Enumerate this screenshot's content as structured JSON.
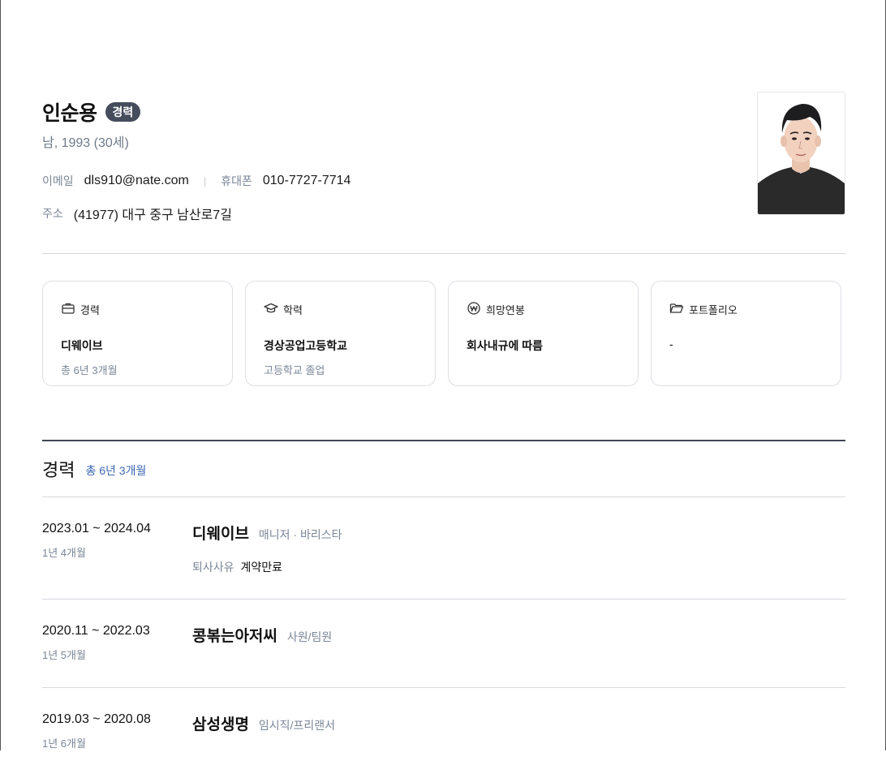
{
  "profile": {
    "name": "인순용",
    "badge": "경력",
    "subtitle": "남, 1993 (30세)",
    "email_label": "이메일",
    "email": "dls910@nate.com",
    "separator": "|",
    "phone_label": "휴대폰",
    "phone": "010-7727-7714",
    "address_label": "주소",
    "address": "(41977) 대구 중구 남산로7길"
  },
  "cards": [
    {
      "icon": "briefcase-icon",
      "title": "경력",
      "main": "디웨이브",
      "sub": "총 6년 3개월"
    },
    {
      "icon": "graduation-cap-icon",
      "title": "학력",
      "main": "경상공업고등학교",
      "sub": "고등학교 졸업"
    },
    {
      "icon": "won-icon",
      "title": "희망연봉",
      "main": "회사내규에 따름",
      "sub": ""
    },
    {
      "icon": "folder-icon",
      "title": "포트폴리오",
      "main": "-",
      "sub": ""
    }
  ],
  "career": {
    "title": "경력",
    "total": "총 6년 3개월",
    "jobs": [
      {
        "period": "2023.01 ~ 2024.04",
        "duration": "1년 4개월",
        "company": "디웨이브",
        "role": "매니저 · 바리스타",
        "reason_label": "퇴사사유",
        "reason": "계약만료"
      },
      {
        "period": "2020.11 ~ 2022.03",
        "duration": "1년 5개월",
        "company": "콩볶는아저씨",
        "role": "사원/팀원"
      },
      {
        "period": "2019.03 ~ 2020.08",
        "duration": "1년 6개월",
        "company": "삼성생명",
        "role": "임시직/프리랜서"
      }
    ]
  },
  "colors": {
    "accent": "#3d67b3",
    "badge": "#454c5c",
    "muted": "#7a8697"
  }
}
